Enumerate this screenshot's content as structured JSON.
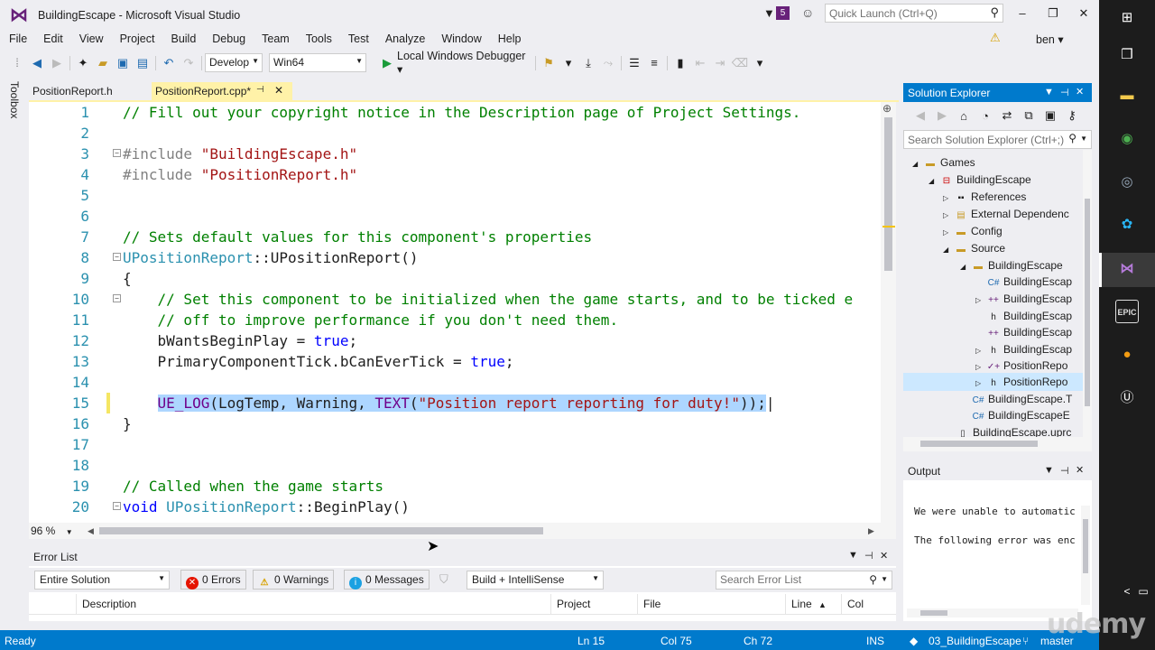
{
  "titlebar": {
    "title": "BuildingEscape - Microsoft Visual Studio",
    "notification_count": "5",
    "quick_launch_placeholder": "Quick Launch (Ctrl+Q)"
  },
  "menu": [
    "File",
    "Edit",
    "View",
    "Project",
    "Build",
    "Debug",
    "Team",
    "Tools",
    "Test",
    "Analyze",
    "Window",
    "Help"
  ],
  "user": "ben",
  "toolbar": {
    "config": "Develop",
    "platform": "Win64",
    "debugger": "Local Windows Debugger"
  },
  "toolbox_label": "Toolbox",
  "tabs": [
    {
      "label": "PositionReport.h"
    },
    {
      "label": "PositionReport.cpp*",
      "active": true
    }
  ],
  "editor": {
    "lines": [
      {
        "n": "1",
        "text": "// Fill out your copyright notice in the Description page of Project Settings."
      },
      {
        "n": "2",
        "text": ""
      },
      {
        "n": "3",
        "text": "#include \"BuildingEscape.h\""
      },
      {
        "n": "4",
        "text": "#include \"PositionReport.h\""
      },
      {
        "n": "5",
        "text": ""
      },
      {
        "n": "6",
        "text": ""
      },
      {
        "n": "7",
        "text": "// Sets default values for this component's properties"
      },
      {
        "n": "8",
        "text": "UPositionReport::UPositionReport()"
      },
      {
        "n": "9",
        "text": "{"
      },
      {
        "n": "10",
        "text": "    // Set this component to be initialized when the game starts, and to be ticked e"
      },
      {
        "n": "11",
        "text": "    // off to improve performance if you don't need them."
      },
      {
        "n": "12",
        "text": "    bWantsBeginPlay = true;"
      },
      {
        "n": "13",
        "text": "    PrimaryComponentTick.bCanEverTick = true;"
      },
      {
        "n": "14",
        "text": ""
      },
      {
        "n": "15",
        "text": "    UE_LOG(LogTemp, Warning, TEXT(\"Position report reporting for duty!\"));"
      },
      {
        "n": "16",
        "text": "}"
      },
      {
        "n": "17",
        "text": ""
      },
      {
        "n": "18",
        "text": ""
      },
      {
        "n": "19",
        "text": "// Called when the game starts"
      },
      {
        "n": "20",
        "text": "void UPositionReport::BeginPlay()"
      }
    ],
    "zoom": "96 %"
  },
  "error_list": {
    "title": "Error List",
    "scope": "Entire Solution",
    "errors": "0 Errors",
    "warnings": "0 Warnings",
    "messages": "0 Messages",
    "build_filter": "Build + IntelliSense",
    "search_placeholder": "Search Error List",
    "columns": [
      "Description",
      "Project",
      "File",
      "Line",
      "Col"
    ]
  },
  "solution_explorer": {
    "title": "Solution Explorer",
    "search_placeholder": "Search Solution Explorer (Ctrl+;)",
    "items": [
      {
        "label": "Games",
        "depth": 0,
        "icon": "folder",
        "expanded": true
      },
      {
        "label": "BuildingEscape",
        "depth": 1,
        "icon": "project",
        "expanded": true
      },
      {
        "label": "References",
        "depth": 2,
        "icon": "references",
        "collapsed": true
      },
      {
        "label": "External Dependenc",
        "depth": 2,
        "icon": "external-deps",
        "collapsed": true
      },
      {
        "label": "Config",
        "depth": 2,
        "icon": "folder",
        "collapsed": true
      },
      {
        "label": "Source",
        "depth": 2,
        "icon": "folder",
        "expanded": true
      },
      {
        "label": "BuildingEscape",
        "depth": 3,
        "icon": "folder",
        "expanded": true
      },
      {
        "label": "BuildingEscap",
        "depth": 4,
        "icon": "cs-file"
      },
      {
        "label": "BuildingEscap",
        "depth": 4,
        "icon": "cpp-file",
        "collapsed": true
      },
      {
        "label": "BuildingEscap",
        "depth": 4,
        "icon": "header-file"
      },
      {
        "label": "BuildingEscap",
        "depth": 4,
        "icon": "cpp-file"
      },
      {
        "label": "BuildingEscap",
        "depth": 4,
        "icon": "header-file",
        "collapsed": true
      },
      {
        "label": "PositionRepo",
        "depth": 4,
        "icon": "cpp-file",
        "collapsed": true
      },
      {
        "label": "PositionRepo",
        "depth": 4,
        "icon": "header-file",
        "collapsed": true,
        "selected": true
      },
      {
        "label": "BuildingEscape.T",
        "depth": 3,
        "icon": "cs-file"
      },
      {
        "label": "BuildingEscapeE",
        "depth": 3,
        "icon": "cs-file"
      },
      {
        "label": "BuildingEscape.uprc",
        "depth": 2,
        "icon": "file"
      }
    ]
  },
  "output": {
    "title": "Output",
    "lines": [
      "We were unable to automatic",
      "The following error was enc"
    ]
  },
  "status": {
    "ready": "Ready",
    "ln": "Ln 15",
    "col": "Col 75",
    "ch": "Ch 72",
    "ins": "INS",
    "repo": "03_BuildingEscape",
    "branch": "master"
  },
  "watermark": "udemy",
  "colors": {
    "accent": "#007acc",
    "vs_purple": "#68217a",
    "selection": "#add6ff",
    "active_tab": "#fff2a8"
  }
}
